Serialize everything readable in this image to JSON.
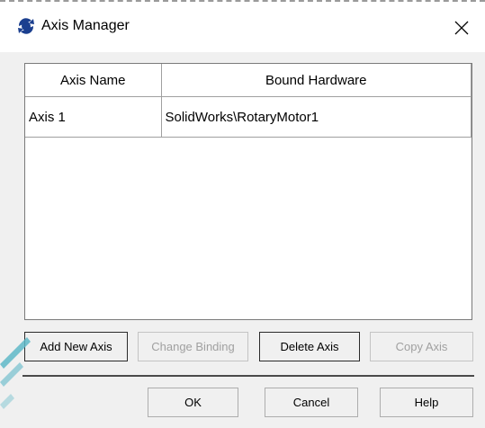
{
  "window": {
    "title": "Axis Manager",
    "icon": "axis-manager-app-icon",
    "close_icon": "close-icon"
  },
  "table": {
    "columns": [
      "Axis Name",
      "Bound Hardware"
    ],
    "rows": [
      {
        "axis_name": "Axis 1",
        "bound_hardware": "SolidWorks\\RotaryMotor1"
      }
    ]
  },
  "actions": {
    "add_new_axis": "Add New Axis",
    "change_binding": "Change Binding",
    "delete_axis": "Delete Axis",
    "copy_axis": "Copy Axis"
  },
  "footer": {
    "ok": "OK",
    "cancel": "Cancel",
    "help": "Help"
  },
  "colors": {
    "dialog_background": "#f0f0f0",
    "disabled_text": "#a0a0a0",
    "watermark": "#5fb8c8"
  }
}
